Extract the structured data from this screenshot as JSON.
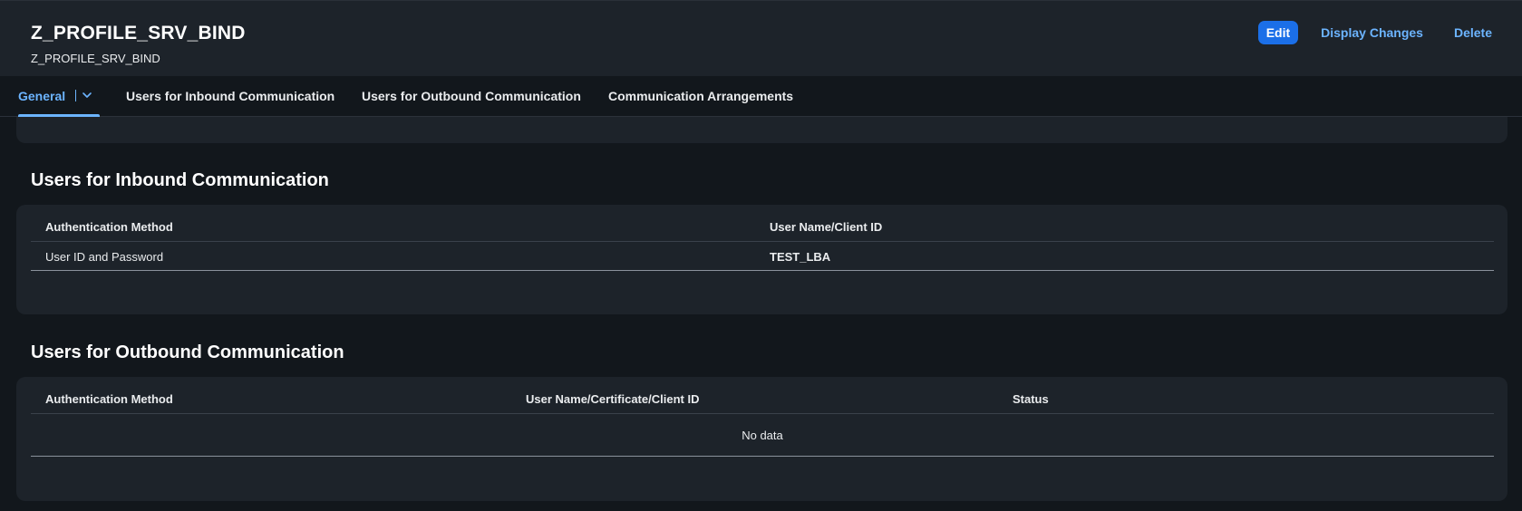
{
  "header": {
    "title": "Z_PROFILE_SRV_BIND",
    "subtitle": "Z_PROFILE_SRV_BIND",
    "actions": {
      "edit": "Edit",
      "display_changes": "Display Changes",
      "delete": "Delete"
    }
  },
  "tabs": [
    {
      "label": "General",
      "selected": true
    },
    {
      "label": "Users for Inbound Communication"
    },
    {
      "label": "Users for Outbound Communication"
    },
    {
      "label": "Communication Arrangements"
    }
  ],
  "inbound": {
    "title": "Users for Inbound Communication",
    "columns": [
      "Authentication Method",
      "User Name/Client ID"
    ],
    "rows": [
      {
        "method": "User ID and Password",
        "user": "TEST_LBA"
      }
    ]
  },
  "outbound": {
    "title": "Users for Outbound Communication",
    "columns": [
      "Authentication Method",
      "User Name/Certificate/Client ID",
      "Status"
    ],
    "empty_text": "No data"
  },
  "colors": {
    "background": "#12171c",
    "card": "#1d232a",
    "accent": "#6cb4ff",
    "emphasized_button": "#1b6fe8"
  }
}
